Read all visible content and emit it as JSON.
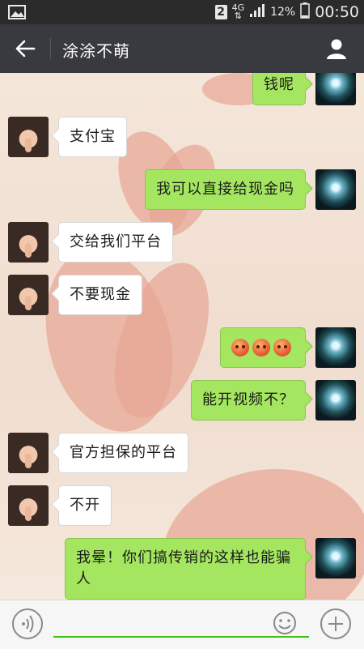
{
  "status_bar": {
    "sim_slot": "2",
    "network": "4G",
    "battery_percent": "12%",
    "time": "00:50"
  },
  "header": {
    "title": "涂涂不萌"
  },
  "messages": [
    {
      "side": "out",
      "text": "钱呢"
    },
    {
      "side": "in",
      "text": "支付宝"
    },
    {
      "side": "out",
      "text": "我可以直接给现金吗"
    },
    {
      "side": "in",
      "text": "交给我们平台"
    },
    {
      "side": "in",
      "text": "不要现金"
    },
    {
      "side": "out",
      "emoji_count": 3,
      "emoji": "face-emoji"
    },
    {
      "side": "out",
      "text": "能开视频不？"
    },
    {
      "side": "in",
      "text": "官方担保的平台"
    },
    {
      "side": "in",
      "text": "不开"
    },
    {
      "side": "out",
      "text": "我晕！你们搞传销的这样也能骗人"
    }
  ],
  "input_bar": {
    "value": "",
    "placeholder": ""
  },
  "colors": {
    "header_bg": "#393a3f",
    "out_bubble": "#a4e65f",
    "in_bubble": "#ffffff",
    "input_underline": "#45c01a"
  }
}
